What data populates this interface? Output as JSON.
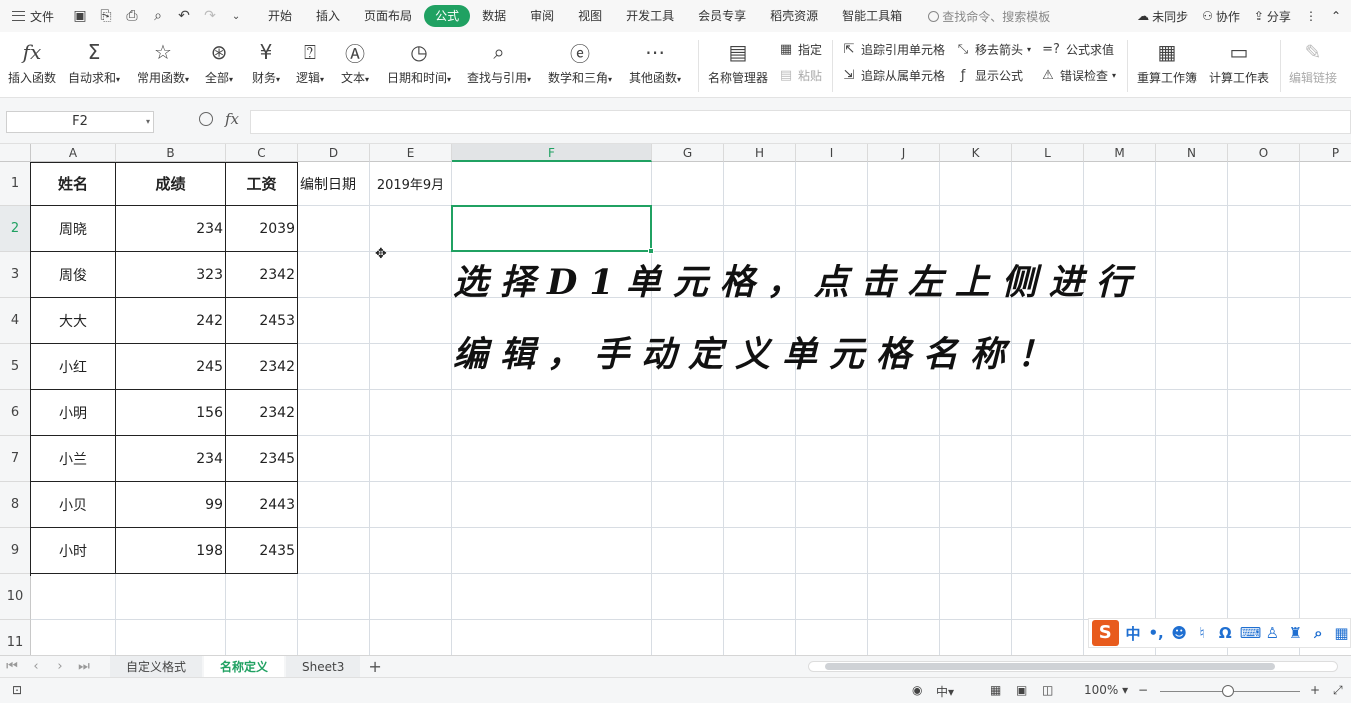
{
  "menubar": {
    "file_label": "文件",
    "tabs": [
      "开始",
      "插入",
      "页面布局",
      "公式",
      "数据",
      "审阅",
      "视图",
      "开发工具",
      "会员专享",
      "稻壳资源",
      "智能工具箱"
    ],
    "active_tab": "公式",
    "search_placeholder": "查找命令、搜索模板",
    "sync_label": "未同步",
    "collab_label": "协作",
    "share_label": "分享"
  },
  "ribbon": {
    "insert_function": "插入函数",
    "autosum": "自动求和",
    "common_functions": "常用函数",
    "all": "全部",
    "financial": "财务",
    "logical": "逻辑",
    "text": "文本",
    "datetime": "日期和时间",
    "lookup": "查找与引用",
    "math": "数学和三角",
    "other": "其他函数",
    "name_manager": "名称管理器",
    "specify": "指定",
    "paste": "粘贴",
    "trace_precedents": "追踪引用单元格",
    "trace_dependents": "追踪从属单元格",
    "remove_arrows": "移去箭头",
    "show_formulas": "显示公式",
    "eval_formula": "公式求值",
    "error_check": "错误检查",
    "recalc_workbook": "重算工作簿",
    "calc_sheet": "计算工作表",
    "edit_links": "编辑链接"
  },
  "formula_bar": {
    "name_box": "F2",
    "fx": "fx",
    "value": ""
  },
  "grid": {
    "columns": [
      "A",
      "B",
      "C",
      "D",
      "E",
      "F",
      "G",
      "H",
      "I",
      "J",
      "K",
      "L",
      "M",
      "N",
      "O",
      "P"
    ],
    "rows": [
      "1",
      "2",
      "3",
      "4",
      "5",
      "6",
      "7",
      "8",
      "9",
      "10",
      "11"
    ],
    "selected_cell": "F2",
    "header": {
      "name": "姓名",
      "score": "成绩",
      "salary": "工资",
      "date_label": "编制日期",
      "date_value": "2019年9月"
    },
    "records": [
      {
        "name": "周晓",
        "score": "234",
        "salary": "2039"
      },
      {
        "name": "周俊",
        "score": "323",
        "salary": "2342"
      },
      {
        "name": "大大",
        "score": "242",
        "salary": "2453"
      },
      {
        "name": "小红",
        "score": "245",
        "salary": "2342"
      },
      {
        "name": "小明",
        "score": "156",
        "salary": "2342"
      },
      {
        "name": "小兰",
        "score": "234",
        "salary": "2345"
      },
      {
        "name": "小贝",
        "score": "99",
        "salary": "2443"
      },
      {
        "name": "小时",
        "score": "198",
        "salary": "2435"
      }
    ]
  },
  "annotation": {
    "line1": "选择D1单元格，点击左上侧进行",
    "line2": "编辑，手动定义单元格名称！"
  },
  "ime": {
    "logo": "S",
    "mode": "中"
  },
  "sheets": {
    "tabs": [
      "自定义格式",
      "名称定义",
      "Sheet3"
    ],
    "active": "名称定义"
  },
  "status": {
    "lang": "中",
    "zoom": "100%"
  },
  "colors": {
    "accent": "#20a162"
  }
}
